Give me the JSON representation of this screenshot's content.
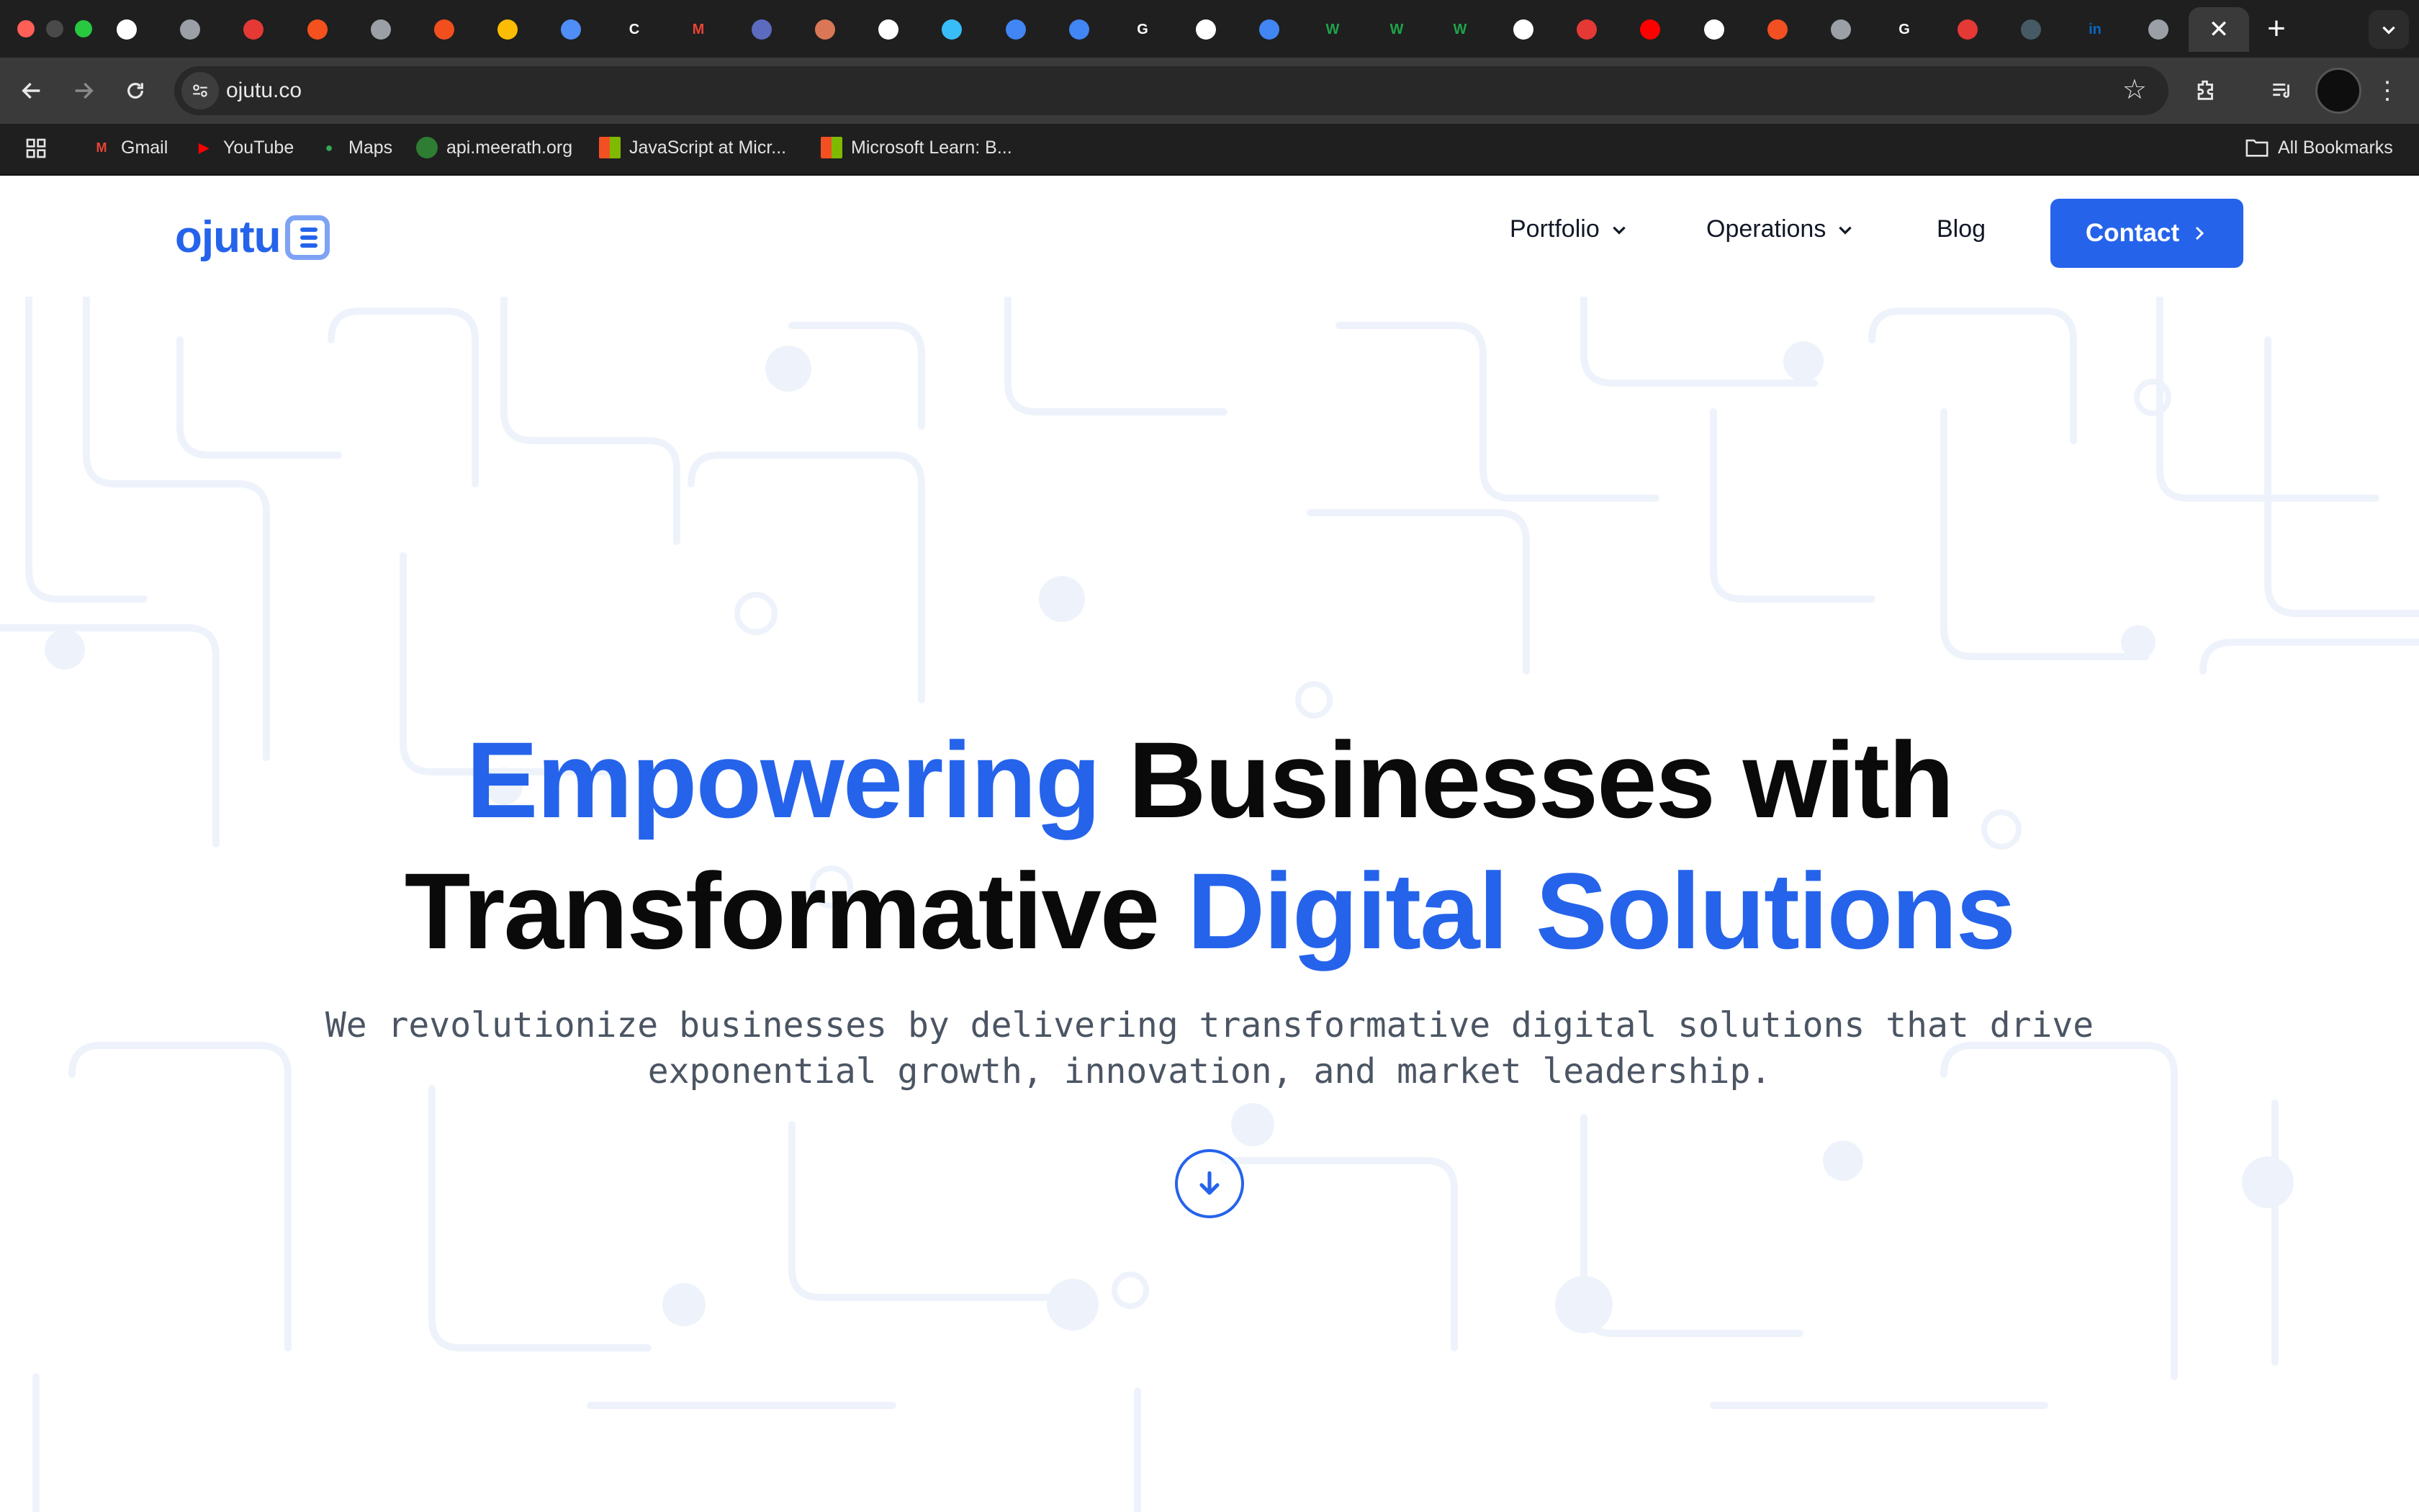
{
  "browser": {
    "url": "ojutu.co",
    "active_tab_close": "✕",
    "new_tab": "+",
    "tabs": [
      {
        "icon": "github-icon",
        "glyph": "",
        "color": "#ffffff"
      },
      {
        "icon": "globe-icon",
        "glyph": "",
        "color": "#9aa0a6"
      },
      {
        "icon": "speedometer-icon",
        "glyph": "",
        "color": "#e53935"
      },
      {
        "icon": "orange-circle-icon",
        "glyph": "",
        "color": "#f4511e"
      },
      {
        "icon": "globe-icon",
        "glyph": "",
        "color": "#9aa0a6"
      },
      {
        "icon": "figma-icon",
        "glyph": "",
        "color": "#f24e1e"
      },
      {
        "icon": "rainbow-icon",
        "glyph": "",
        "color": "#fbbc04"
      },
      {
        "icon": "window-icon",
        "glyph": "",
        "color": "#4f8ef7"
      },
      {
        "icon": "c-letter-icon",
        "glyph": "C",
        "color": "#ffffff"
      },
      {
        "icon": "gmail-icon",
        "glyph": "M",
        "color": "#ea4335"
      },
      {
        "icon": "bird-icon",
        "glyph": "",
        "color": "#5c6bc0"
      },
      {
        "icon": "claude-icon",
        "glyph": "",
        "color": "#d97757"
      },
      {
        "icon": "openai-icon",
        "glyph": "",
        "color": "#ffffff"
      },
      {
        "icon": "tailwind-icon",
        "glyph": "",
        "color": "#38bdf8"
      },
      {
        "icon": "docs-icon",
        "glyph": "",
        "color": "#4285f4"
      },
      {
        "icon": "docs-icon",
        "glyph": "",
        "color": "#4285f4"
      },
      {
        "icon": "google-icon",
        "glyph": "G",
        "color": "#ffffff"
      },
      {
        "icon": "circle-a-icon",
        "glyph": "",
        "color": "#ffffff"
      },
      {
        "icon": "docs-icon",
        "glyph": "",
        "color": "#4285f4"
      },
      {
        "icon": "w-icon",
        "glyph": "W",
        "color": "#1fa34a"
      },
      {
        "icon": "w-circle-icon",
        "glyph": "W",
        "color": "#1fa34a"
      },
      {
        "icon": "w-icon",
        "glyph": "W",
        "color": "#1fa34a"
      },
      {
        "icon": "github-icon",
        "glyph": "",
        "color": "#ffffff"
      },
      {
        "icon": "red-circle-icon",
        "glyph": "",
        "color": "#e53935"
      },
      {
        "icon": "youtube-icon",
        "glyph": "",
        "color": "#ff0000"
      },
      {
        "icon": "openai-icon",
        "glyph": "",
        "color": "#ffffff"
      },
      {
        "icon": "microsoft-icon",
        "glyph": "",
        "color": "#f25022"
      },
      {
        "icon": "loading-icon",
        "glyph": "",
        "color": "#9aa0a6"
      },
      {
        "icon": "google-icon",
        "glyph": "G",
        "color": "#ffffff"
      },
      {
        "icon": "red-cloud-icon",
        "glyph": "",
        "color": "#e53935"
      },
      {
        "icon": "portrait-icon",
        "glyph": "",
        "color": "#455a64"
      },
      {
        "icon": "linkedin-icon",
        "glyph": "in",
        "color": "#0a66c2"
      },
      {
        "icon": "globe-icon",
        "glyph": "",
        "color": "#9aa0a6"
      }
    ],
    "bookmarks": [
      {
        "label": "Gmail",
        "icon": "gmail-icon",
        "glyph": "M",
        "color": "#ea4335"
      },
      {
        "label": "YouTube",
        "icon": "youtube-icon",
        "glyph": "▶",
        "color": "#ff0000"
      },
      {
        "label": "Maps",
        "icon": "maps-pin-icon",
        "glyph": "●",
        "color": "#34a853"
      },
      {
        "label": "api.meerath.org",
        "icon": "feather-icon",
        "glyph": "",
        "color": "#2e7d32"
      },
      {
        "label": "JavaScript at Micr...",
        "icon": "microsoft-icon",
        "glyph": "",
        "color": "#f25022"
      },
      {
        "label": "Microsoft Learn: B...",
        "icon": "microsoft-icon",
        "glyph": "",
        "color": "#f25022"
      }
    ],
    "all_bookmarks": "All Bookmarks"
  },
  "site": {
    "logo_text": "ojutu",
    "nav": {
      "portfolio": "Portfolio",
      "operations": "Operations",
      "blog": "Blog",
      "contact": "Contact"
    },
    "hero": {
      "title_part1": "Empowering",
      "title_part2": " Businesses with",
      "title_part3": "Transformative ",
      "title_part4": "Digital Solutions",
      "subtitle": "We revolutionize businesses by delivering transformative digital solutions that drive exponential growth, innovation, and market leadership."
    },
    "colors": {
      "accent": "#2563eb",
      "heading": "#0a0a0a",
      "body": "#4b5563",
      "pattern": "#eef3fb"
    }
  }
}
